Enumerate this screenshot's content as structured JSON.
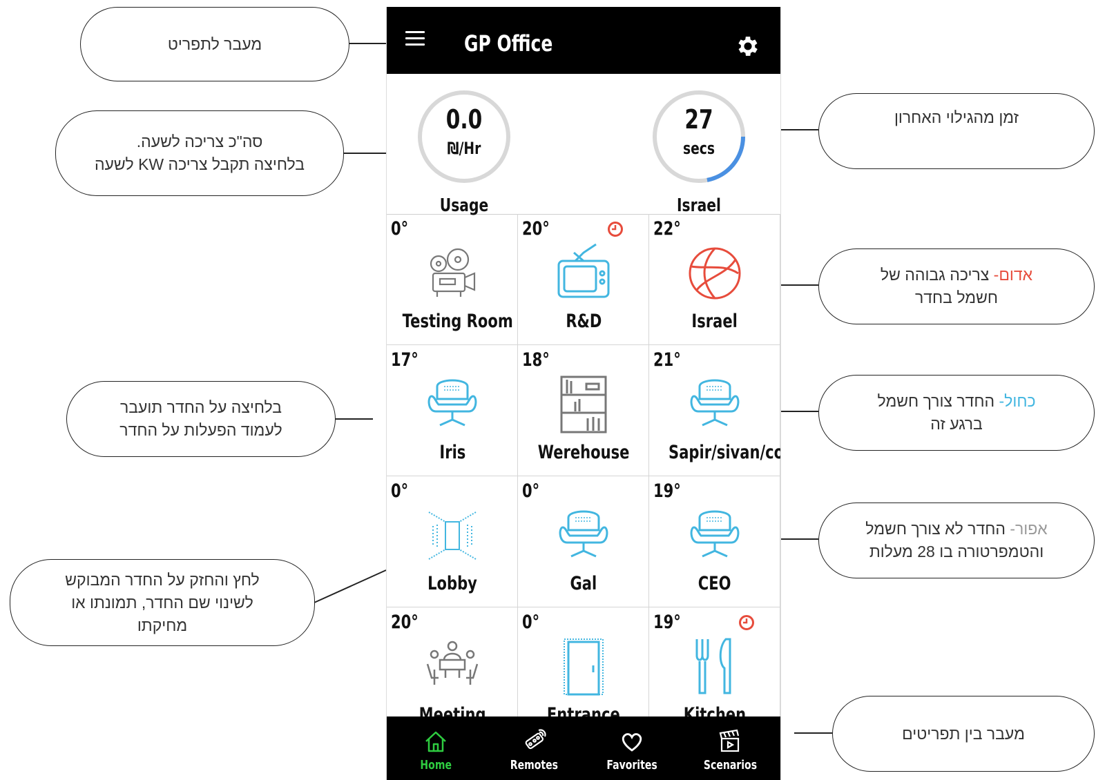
{
  "app": {
    "title": "GP Office",
    "colors": {
      "active": "#2ecc40",
      "blue": "#42b6e0",
      "red": "#e74c3c",
      "gauge_fill": "#4a90e2"
    }
  },
  "gauges": {
    "usage": {
      "value": "0.0",
      "unit": "₪/Hr",
      "label": "Usage"
    },
    "israel": {
      "value": "27",
      "unit": "secs",
      "label": "Israel",
      "progress": 0.22
    }
  },
  "rooms": [
    {
      "temp": "0°",
      "name": "Testing Room",
      "icon": "projector-icon",
      "status": "gray",
      "clock": false
    },
    {
      "temp": "20°",
      "name": "R&D",
      "icon": "tv-icon",
      "status": "blue",
      "clock": true
    },
    {
      "temp": "22°",
      "name": "Israel",
      "icon": "ball-icon",
      "status": "red",
      "clock": false
    },
    {
      "temp": "17°",
      "name": "Iris",
      "icon": "chair-icon",
      "status": "blue",
      "clock": false
    },
    {
      "temp": "18°",
      "name": "Werehouse",
      "icon": "shelf-icon",
      "status": "gray",
      "clock": false
    },
    {
      "temp": "21°",
      "name": "Sapir/sivan/coral",
      "icon": "chair-icon",
      "status": "blue",
      "clock": false
    },
    {
      "temp": "0°",
      "name": "Lobby",
      "icon": "lobby-icon",
      "status": "blue",
      "clock": false
    },
    {
      "temp": "0°",
      "name": "Gal",
      "icon": "chair-icon",
      "status": "blue",
      "clock": false
    },
    {
      "temp": "19°",
      "name": "CEO",
      "icon": "chair-icon",
      "status": "blue",
      "clock": false
    },
    {
      "temp": "20°",
      "name": "Meeting",
      "icon": "meeting-icon",
      "status": "gray",
      "clock": false
    },
    {
      "temp": "0°",
      "name": "Entrance",
      "icon": "door-icon",
      "status": "blue",
      "clock": false
    },
    {
      "temp": "19°",
      "name": "Kitchen",
      "icon": "cutlery-icon",
      "status": "blue",
      "clock": true
    }
  ],
  "nav": [
    {
      "label": "Home",
      "icon": "home-icon",
      "active": true
    },
    {
      "label": "Remotes",
      "icon": "remote-icon",
      "active": false
    },
    {
      "label": "Favorites",
      "icon": "heart-icon",
      "active": false
    },
    {
      "label": "Scenarios",
      "icon": "clapper-icon",
      "active": false
    }
  ],
  "annotations": {
    "menu": "מעבר לתפריט",
    "usage_line1": "סה\"כ צריכה לשעה.",
    "usage_line2": "בלחיצה תקבל צריכה KW לשעה",
    "room_click_line1": "בלחיצה על החדר תועבר",
    "room_click_line2": "לעמוד הפעלות על החדר",
    "long_press_line1": "לחץ והחזק על החדר המבוקש",
    "long_press_line2": "לשינוי שם החדר, תמונתו או",
    "long_press_line3": "מחיקתו",
    "last_discovery": "זמן מהגילוי האחרון",
    "red_word": "אדום-",
    "red_rest": " צריכה גבוהה של",
    "red_line2": "חשמל בחדר",
    "blue_word": "כחול-",
    "blue_rest": " החדר צורך חשמל",
    "blue_line2": "ברגע זה",
    "gray_word": "אפור-",
    "gray_rest": " החדר לא צורך חשמל",
    "gray_line2": "והטמפרטורה בו 28 מעלות",
    "nav_switch": "מעבר בין תפריטים"
  }
}
